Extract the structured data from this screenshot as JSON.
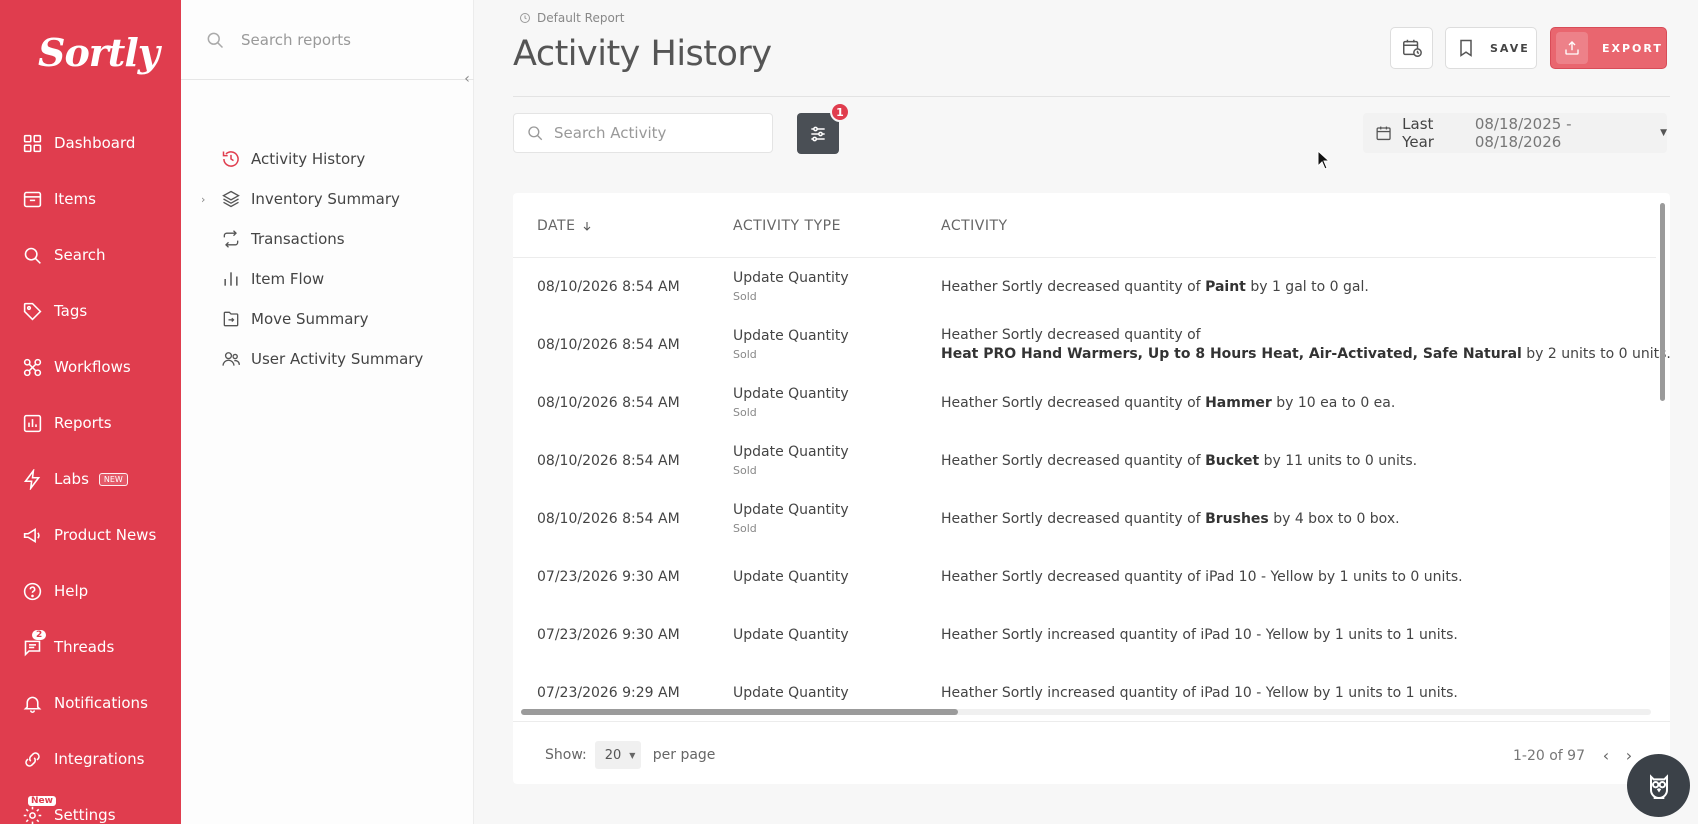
{
  "brand": {
    "logo_text": "Sortly",
    "accent": "#e03d4e"
  },
  "nav": {
    "items": [
      {
        "label": "Dashboard",
        "icon": "dashboard-icon"
      },
      {
        "label": "Items",
        "icon": "items-icon"
      },
      {
        "label": "Search",
        "icon": "search-icon"
      },
      {
        "label": "Tags",
        "icon": "tag-icon"
      },
      {
        "label": "Workflows",
        "icon": "workflows-icon"
      },
      {
        "label": "Reports",
        "icon": "reports-icon"
      },
      {
        "label": "Labs",
        "icon": "lightning-icon",
        "badge": "NEW"
      },
      {
        "label": "Product News",
        "icon": "megaphone-icon"
      },
      {
        "label": "Help",
        "icon": "help-icon"
      },
      {
        "label": "Threads",
        "icon": "threads-icon",
        "count": "2"
      },
      {
        "label": "Notifications",
        "icon": "bell-icon"
      },
      {
        "label": "Integrations",
        "icon": "integrations-icon"
      },
      {
        "label": "Settings",
        "icon": "gear-icon",
        "badge": "New"
      }
    ]
  },
  "reports_sidebar": {
    "search_placeholder": "Search reports",
    "items": [
      {
        "label": "Activity History",
        "icon": "history-icon"
      },
      {
        "label": "Inventory Summary",
        "icon": "layers-icon",
        "expandable": true
      },
      {
        "label": "Transactions",
        "icon": "transactions-icon"
      },
      {
        "label": "Item Flow",
        "icon": "bar-chart-icon"
      },
      {
        "label": "Move Summary",
        "icon": "move-icon"
      },
      {
        "label": "User Activity Summary",
        "icon": "users-icon"
      }
    ]
  },
  "header": {
    "breadcrumb": "Default Report",
    "title": "Activity History",
    "save_label": "SAVE",
    "export_label": "EXPORT"
  },
  "filters": {
    "search_placeholder": "Search Activity",
    "filter_count": "1",
    "date_label": "Last Year",
    "date_range": "08/18/2025 - 08/18/2026"
  },
  "table": {
    "columns": {
      "date": "DATE",
      "type": "ACTIVITY TYPE",
      "activity": "ACTIVITY"
    },
    "rows": [
      {
        "date": "08/10/2026 8:54 AM",
        "type": "Update Quantity",
        "sub": "Sold",
        "pre": "Heather Sortly decreased quantity of ",
        "item": "Paint",
        "post": " by 1 gal to 0 gal."
      },
      {
        "date": "08/10/2026 8:54 AM",
        "type": "Update Quantity",
        "sub": "Sold",
        "pre": "Heather Sortly decreased quantity of",
        "item": "Heat PRO Hand Warmers, Up to 8 Hours Heat, Air-Activated, Safe Natural",
        "post": " by 2 units to 0 units.",
        "wrap": true
      },
      {
        "date": "08/10/2026 8:54 AM",
        "type": "Update Quantity",
        "sub": "Sold",
        "pre": "Heather Sortly decreased quantity of ",
        "item": "Hammer",
        "post": " by 10 ea to 0 ea."
      },
      {
        "date": "08/10/2026 8:54 AM",
        "type": "Update Quantity",
        "sub": "Sold",
        "pre": "Heather Sortly decreased quantity of ",
        "item": "Bucket",
        "post": " by 11 units to 0 units."
      },
      {
        "date": "08/10/2026 8:54 AM",
        "type": "Update Quantity",
        "sub": "Sold",
        "pre": "Heather Sortly decreased quantity of ",
        "item": "Brushes",
        "post": " by 4 box to 0 box."
      },
      {
        "date": "07/23/2026 9:30 AM",
        "type": "Update Quantity",
        "sub": "",
        "pre": "Heather Sortly decreased quantity of iPad 10 - Yellow by 1 units to 0 units.",
        "item": "",
        "post": ""
      },
      {
        "date": "07/23/2026 9:30 AM",
        "type": "Update Quantity",
        "sub": "",
        "pre": "Heather Sortly increased quantity of iPad 10 - Yellow by 1 units to 1 units.",
        "item": "",
        "post": ""
      },
      {
        "date": "07/23/2026 9:29 AM",
        "type": "Update Quantity",
        "sub": "",
        "pre": "Heather Sortly increased quantity of iPad 10 - Yellow by 1 units to 1 units.",
        "item": "",
        "post": ""
      }
    ]
  },
  "pagination": {
    "show_label": "Show:",
    "per_page_value": "20",
    "per_page_label": "per page",
    "range": "1-20 of 97"
  }
}
